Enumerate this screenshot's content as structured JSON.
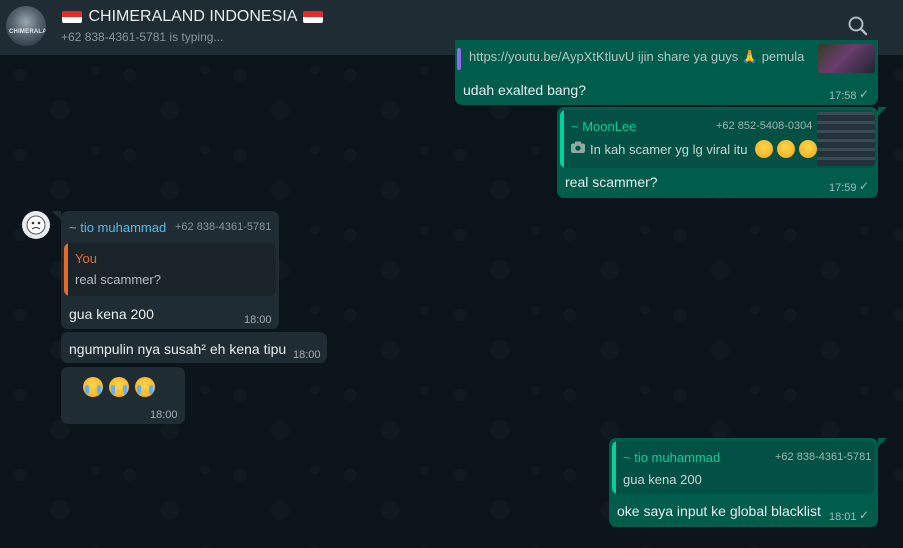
{
  "header": {
    "avatar_label": "CHIMERALAND",
    "title": "CHIMERALAND INDONESIA",
    "subtitle": "+62 838-4361-5781 is typing..."
  },
  "messages": [
    {
      "id": "m1",
      "dir": "out",
      "partial_line": "https://youtu.be/AypXtKtluvU ijin share ya guys 🙏  pemula",
      "text": "udah exalted bang?",
      "time": "17:58"
    },
    {
      "id": "m2",
      "dir": "out",
      "quote": {
        "author": "~ MoonLee",
        "phone": "+62 852-5408-0304",
        "text": "In kah scamer yg lg viral itu"
      },
      "text": "real scammer?",
      "time": "17:59"
    },
    {
      "id": "m3",
      "dir": "in",
      "sender": "~ tio muhammad",
      "sender_phone": "+62 838-4361-5781",
      "quote": {
        "author": "You",
        "text": "real scammer?"
      },
      "text": "gua kena 200",
      "time": "18:00"
    },
    {
      "id": "m4",
      "dir": "in",
      "text": "ngumpulin nya susah² eh kena tipu",
      "time": "18:00"
    },
    {
      "id": "m5",
      "dir": "in",
      "emoji_count": 3,
      "time": "18:00"
    },
    {
      "id": "m6",
      "dir": "out",
      "quote": {
        "author": "~ tio muhammad",
        "phone": "+62 838-4361-5781",
        "text": "gua kena 200"
      },
      "text": "oke saya input ke global blacklist",
      "time": "18:01"
    }
  ],
  "colors": {
    "outgoing_bubble": "#005c4b",
    "incoming_bubble": "#202c33",
    "header_bg": "#202c33",
    "chat_bg": "#0b141a",
    "quote_green": "#06cf9c",
    "quote_you": "#e26b2f",
    "sender_name": "#53bdeb"
  },
  "icons": {
    "search": "search-icon",
    "read_receipt": "double-check-icon",
    "camera": "camera-icon"
  }
}
